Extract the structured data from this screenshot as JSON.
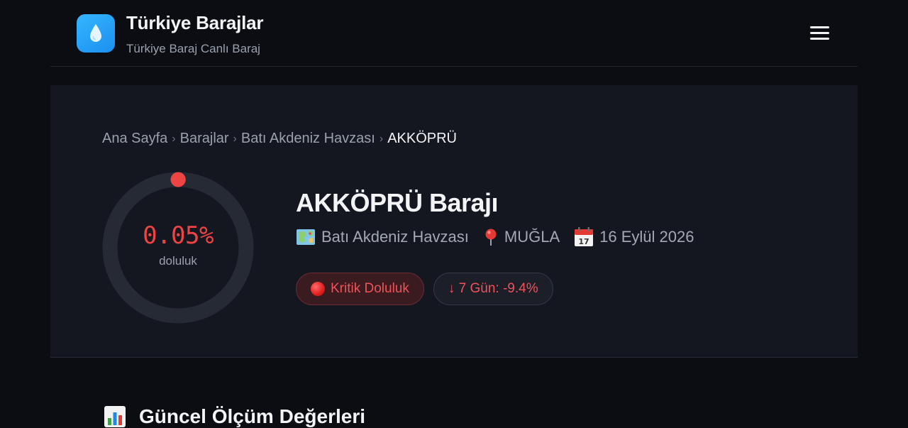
{
  "header": {
    "title": "Türkiye Barajlar",
    "subtitle": "Türkiye Baraj Canlı Baraj",
    "logo_icon": "water-drop-icon",
    "menu_icon": "hamburger-menu-icon"
  },
  "breadcrumb": {
    "items": [
      "Ana Sayfa",
      "Barajlar",
      "Batı Akdeniz Havzası"
    ],
    "current": "AKKÖPRÜ",
    "separator": "›"
  },
  "gauge": {
    "value_text": "0.05%",
    "value": 0.05,
    "label": "doluluk",
    "color": "#ef4444"
  },
  "dam": {
    "title": "AKKÖPRÜ Barajı",
    "basin": "Batı Akdeniz Havzası",
    "basin_icon": "map-icon",
    "province": "MUĞLA",
    "province_icon": "pin-icon",
    "date": "16 Eylül 2026",
    "date_icon": "calendar-icon"
  },
  "badges": {
    "status": "Kritik Doluluk",
    "trend": "↓ 7 Gün: -9.4%"
  },
  "section": {
    "title": "Güncel Ölçüm Değerleri",
    "icon": "bar-chart-icon"
  },
  "colors": {
    "background": "#0b0d12",
    "panel": "#141720",
    "accent_blue": "#1b8ff0",
    "critical_red": "#ef4444"
  }
}
